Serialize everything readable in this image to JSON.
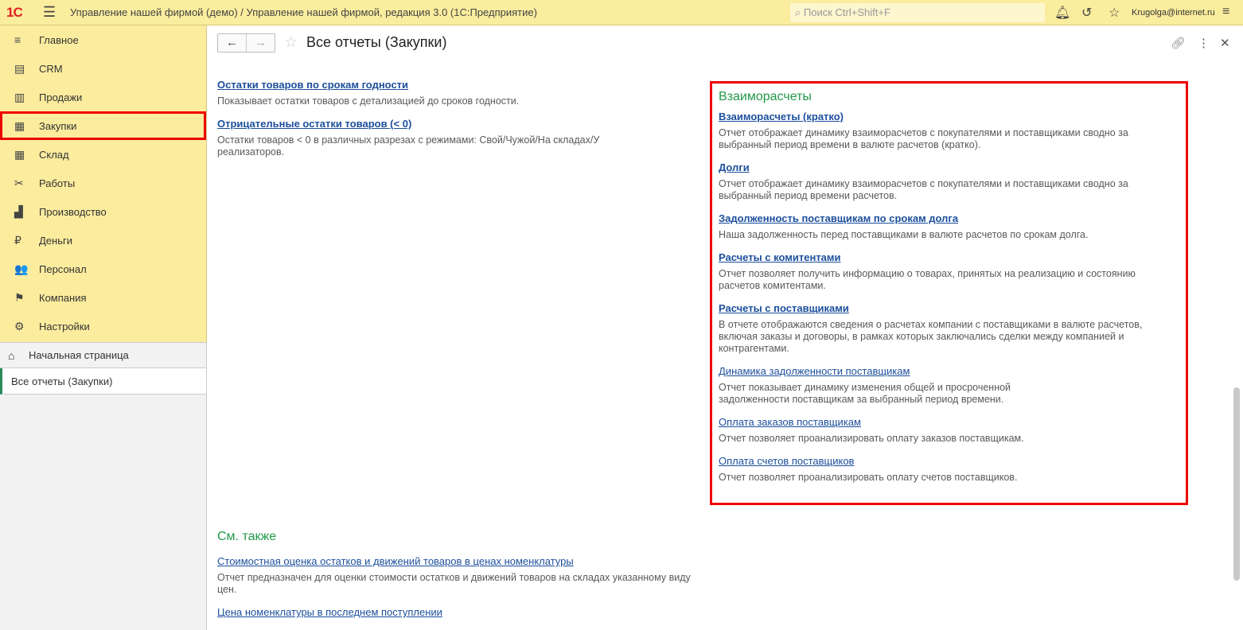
{
  "topbar": {
    "logo": "1С",
    "title": "Управление нашей фирмой (демо) / Управление нашей фирмой, редакция 3.0  (1С:Предприятие)",
    "search_placeholder": "Поиск Ctrl+Shift+F",
    "user": "Krugolga@internet.ru"
  },
  "sidebar": {
    "items": [
      {
        "label": "Главное",
        "icon": "≡"
      },
      {
        "label": "CRM",
        "icon": "▤"
      },
      {
        "label": "Продажи",
        "icon": "▥"
      },
      {
        "label": "Закупки",
        "icon": "▦"
      },
      {
        "label": "Склад",
        "icon": "▦"
      },
      {
        "label": "Работы",
        "icon": "✂"
      },
      {
        "label": "Производство",
        "icon": "▟"
      },
      {
        "label": "Деньги",
        "icon": "₽"
      },
      {
        "label": "Персонал",
        "icon": "👥"
      },
      {
        "label": "Компания",
        "icon": "⚑"
      },
      {
        "label": "Настройки",
        "icon": "⚙"
      }
    ],
    "home": "Начальная страница",
    "open_tab": "Все отчеты (Закупки)"
  },
  "page": {
    "title": "Все отчеты (Закупки)"
  },
  "left_reports": [
    {
      "title": "Остатки товаров по срокам годности",
      "desc": "Показывает остатки товаров с детализацией до сроков годности."
    },
    {
      "title": "Отрицательные остатки товаров (< 0)",
      "desc": "Остатки товаров < 0 в различных разрезах с режимами: Свой/Чужой/На складах/У реализаторов."
    }
  ],
  "settlements": {
    "heading": "Взаиморасчеты",
    "reports": [
      {
        "title": "Взаиморасчеты (кратко)",
        "desc": "Отчет отображает динамику взаиморасчетов с покупателями и поставщиками сводно за выбранный период времени в валюте расчетов (кратко)."
      },
      {
        "title": "Долги",
        "desc": "Отчет отображает динамику взаиморасчетов с покупателями и поставщиками сводно за выбранный период времени расчетов."
      },
      {
        "title": "Задолженность поставщикам по срокам долга",
        "desc": "Наша задолженность перед поставщиками в валюте расчетов по срокам долга."
      },
      {
        "title": "Расчеты с комитентами",
        "desc": "Отчет позволяет получить информацию о товарах, принятых на реализацию и состоянию расчетов комитентами."
      },
      {
        "title": "Расчеты с поставщиками",
        "desc": "В отчете отображаются сведения о расчетах компании с поставщиками в валюте расчетов, включая заказы и договоры, в рамках которых заключались сделки между компанией и контрагентами."
      },
      {
        "title": "Динамика задолженности поставщикам",
        "desc": "Отчет показывает динамику изменения общей и просроченной задолженности поставщикам за выбранный период времени."
      },
      {
        "title": "Оплата заказов поставщикам",
        "desc": "Отчет позволяет проанализировать оплату заказов поставщикам."
      },
      {
        "title": "Оплата счетов поставщиков",
        "desc": "Отчет позволяет проанализировать оплату счетов поставщиков."
      }
    ]
  },
  "see_also": {
    "heading": "См. также",
    "reports": [
      {
        "title": "Стоимостная оценка остатков и движений товаров в ценах номенклатуры",
        "desc": "Отчет предназначен для оценки стоимости остатков и движений товаров на складах указанному виду цен."
      },
      {
        "title": "Цена номенклатуры в последнем поступлении",
        "desc": ""
      }
    ]
  }
}
